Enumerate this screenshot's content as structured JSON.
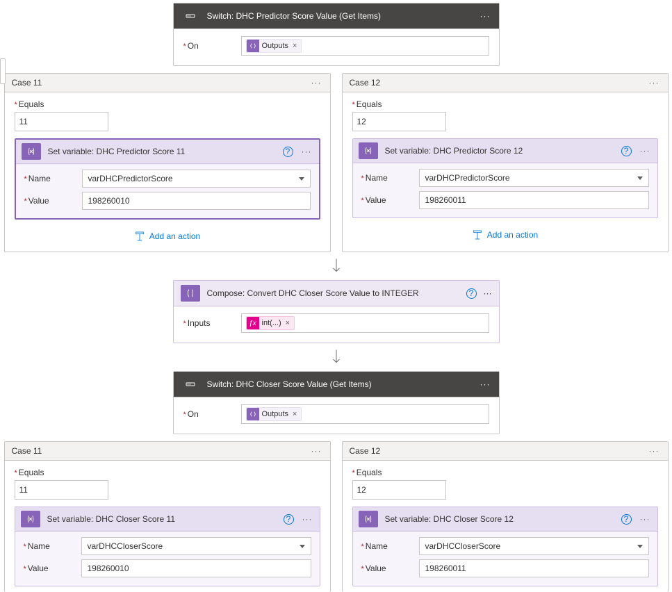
{
  "topSwitch": {
    "title": "Switch: DHC Predictor Score Value (Get Items)",
    "on_label": "On",
    "chip_label": "Outputs"
  },
  "predictor": {
    "equals_label": "Equals",
    "name_label": "Name",
    "value_label": "Value",
    "add_action": "Add an action",
    "left": {
      "case_title": "Case 11",
      "equals_value": "11",
      "inner_title": "Set variable: DHC Predictor Score 11",
      "name_value": "varDHCPredictorScore",
      "value_value": "198260010"
    },
    "right": {
      "case_title": "Case 12",
      "equals_value": "12",
      "inner_title": "Set variable: DHC Predictor Score 12",
      "name_value": "varDHCPredictorScore",
      "value_value": "198260011"
    }
  },
  "compose": {
    "title": "Compose: Convert DHC Closer Score Value to INTEGER",
    "inputs_label": "Inputs",
    "chip_label": "int(...)"
  },
  "closerSwitch": {
    "title": "Switch: DHC Closer Score Value (Get Items)",
    "on_label": "On",
    "chip_label": "Outputs"
  },
  "closer": {
    "equals_label": "Equals",
    "name_label": "Name",
    "value_label": "Value",
    "left": {
      "case_title": "Case 11",
      "equals_value": "11",
      "inner_title": "Set variable: DHC Closer Score 11",
      "name_value": "varDHCCloserScore",
      "value_value": "198260010"
    },
    "right": {
      "case_title": "Case 12",
      "equals_value": "12",
      "inner_title": "Set variable: DHC Closer Score 12",
      "name_value": "varDHCCloserScore",
      "value_value": "198260011"
    }
  }
}
